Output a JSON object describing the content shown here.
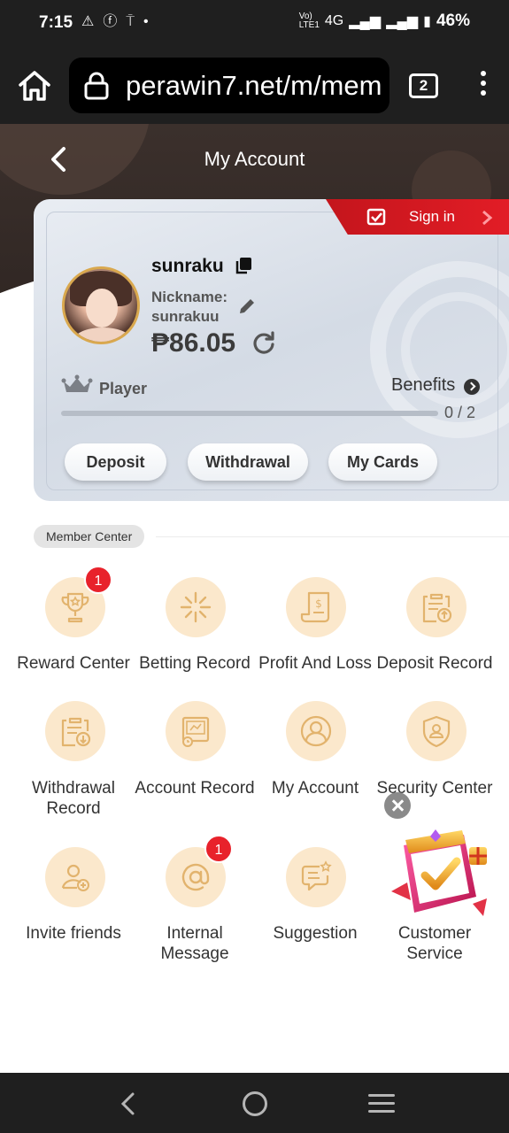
{
  "status_bar": {
    "time": "7:15",
    "battery": "46%",
    "network": "4G"
  },
  "browser": {
    "url": "perawin7.net/m/mem",
    "tab_count": "2"
  },
  "header": {
    "title": "My Account"
  },
  "account": {
    "signin_label": "Sign in",
    "username": "sunraku",
    "nickname_label": "Nickname:",
    "nickname": "sunrakuu",
    "balance": "₱86.05",
    "level": "Player",
    "benefits_label": "Benefits",
    "progress_text": "0 / 2",
    "progress_fraction": 0,
    "buttons": {
      "deposit": "Deposit",
      "withdrawal": "Withdrawal",
      "cards": "My Cards"
    }
  },
  "member_center": {
    "title": "Member Center",
    "items": [
      {
        "label": "Reward Center",
        "icon": "trophy-icon",
        "badge": "1"
      },
      {
        "label": "Betting Record",
        "icon": "sparkle-icon"
      },
      {
        "label": "Profit And Loss",
        "icon": "receipt-icon"
      },
      {
        "label": "Deposit Record",
        "icon": "clipboard-upload-icon"
      },
      {
        "label": "Withdrawal Record",
        "icon": "clipboard-download-icon"
      },
      {
        "label": "Account Record",
        "icon": "certificate-icon"
      },
      {
        "label": "My Account",
        "icon": "user-icon"
      },
      {
        "label": "Security Center",
        "icon": "shield-user-icon"
      },
      {
        "label": "Invite friends",
        "icon": "add-user-icon"
      },
      {
        "label": "Internal Message",
        "icon": "at-icon",
        "badge": "1"
      },
      {
        "label": "Suggestion",
        "icon": "chat-star-icon"
      },
      {
        "label": "Customer Service",
        "icon": "gift-box-icon"
      }
    ]
  },
  "colors": {
    "accent_red": "#e21d26",
    "icon_bg": "#fbe8cc",
    "icon_stroke": "#e2b36d",
    "header_bg": "#2d2421"
  }
}
